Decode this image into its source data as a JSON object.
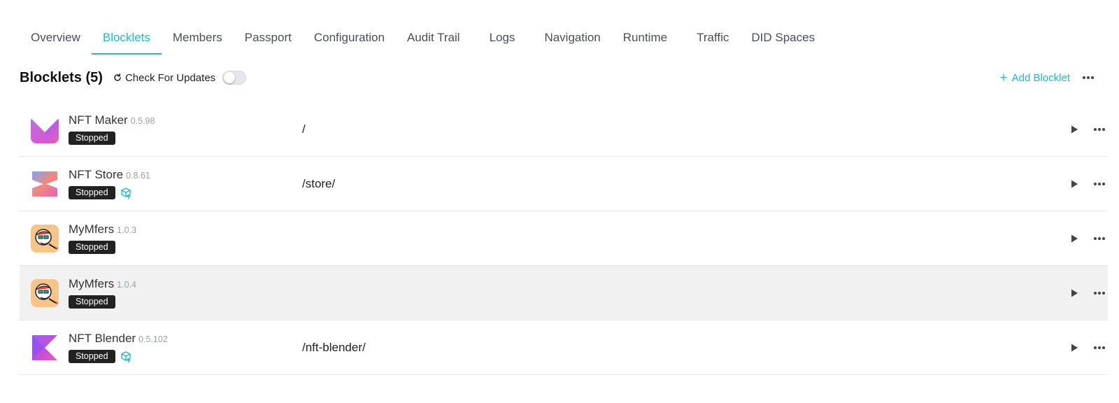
{
  "tabs": [
    {
      "label": "Overview"
    },
    {
      "label": "Blocklets",
      "active": true
    },
    {
      "label": "Members"
    },
    {
      "label": "Passport"
    },
    {
      "label": "Configuration"
    },
    {
      "label": "Audit Trail"
    },
    {
      "label": "Logs"
    },
    {
      "label": "Navigation"
    },
    {
      "label": "Runtime"
    },
    {
      "label": "Traffic"
    },
    {
      "label": "DID Spaces"
    }
  ],
  "header": {
    "title": "Blocklets (5)",
    "check_updates_label": "Check For Updates",
    "check_updates_enabled": false,
    "add_label": "Add Blocklet"
  },
  "colors": {
    "accent": "#27b6c4",
    "badge_bg": "#222222",
    "hover_row": "#f1f1f1"
  },
  "blocklets": [
    {
      "name": "NFT Maker",
      "version": "0.5.98",
      "status": "Stopped",
      "path": "/",
      "logo_icon": "nft-maker-logo",
      "upgrade_available": false
    },
    {
      "name": "NFT Store",
      "version": "0.8.61",
      "status": "Stopped",
      "path": "/store/",
      "logo_icon": "nft-store-logo",
      "upgrade_available": true
    },
    {
      "name": "MyMfers",
      "version": "1.0.3",
      "status": "Stopped",
      "path": "",
      "logo_icon": "mymfers-logo",
      "upgrade_available": false
    },
    {
      "name": "MyMfers",
      "version": "1.0.4",
      "status": "Stopped",
      "path": "",
      "logo_icon": "mymfers-logo",
      "upgrade_available": false
    },
    {
      "name": "NFT Blender",
      "version": "0.5.102",
      "status": "Stopped",
      "path": "/nft-blender/",
      "logo_icon": "nft-blender-logo",
      "upgrade_available": true
    }
  ]
}
